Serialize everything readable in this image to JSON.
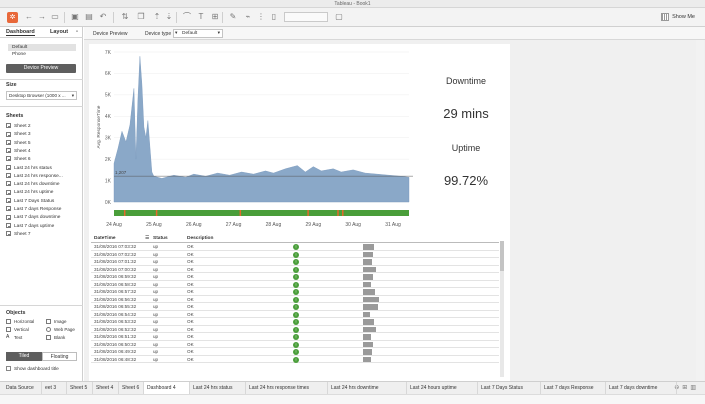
{
  "window": {
    "title": "Tableau - Book1"
  },
  "toolbar": {
    "show_me_label": "Show Me"
  },
  "left_panel": {
    "tabs": [
      {
        "label": "Dashboard"
      },
      {
        "label": "Layout"
      }
    ],
    "device_items": [
      {
        "label": "Default"
      },
      {
        "label": "Phone"
      }
    ],
    "device_preview_button": "Device Preview",
    "size_section": "Size",
    "size_value": "Desktop Browser (1000 x ...",
    "sheets_section": "Sheets",
    "sheets": [
      "Sheet 2",
      "Sheet 3",
      "Sheet 5",
      "Sheet 4",
      "Sheet 6",
      "Last 24 hrs status",
      "Last 24 hrs response...",
      "Last 24 hrs downtime",
      "Last 24 hrs uptime",
      "Last 7 Days Status",
      "Last 7 days Response",
      "Last 7 days downtime",
      "Last 7 days uptime",
      "Sheet 7"
    ],
    "objects_section": "Objects",
    "objects": [
      {
        "label": "Horizontal"
      },
      {
        "label": "Image"
      },
      {
        "label": "Vertical"
      },
      {
        "label": "Web Page"
      },
      {
        "label": "Text"
      },
      {
        "label": "Blank"
      }
    ],
    "tiled_label": "Tiled",
    "floating_label": "Floating",
    "show_title_label": "Show dashboard title"
  },
  "device_bar": {
    "preview_label": "Device Preview",
    "type_label": "Device type",
    "type_value": "Default"
  },
  "kpis": {
    "downtime_label": "Downtime",
    "downtime_value": "29 mins",
    "uptime_label": "Uptime",
    "uptime_value": "99.72%"
  },
  "chart_data": {
    "type": "area",
    "title": "",
    "ylabel": "Avg. ResponseTime",
    "xlabel": "",
    "yticks": [
      "0K",
      "1K",
      "2K",
      "3K",
      "4K",
      "5K",
      "6K",
      "7K"
    ],
    "ylim": [
      0,
      7000
    ],
    "xticks": [
      "24 Aug",
      "25 Aug",
      "26 Aug",
      "27 Aug",
      "28 Aug",
      "29 Aug",
      "30 Aug",
      "31 Aug"
    ],
    "reference_line": {
      "label": "1,207",
      "value": 1207
    },
    "series": [
      {
        "points": [
          [
            0.0,
            1800
          ],
          [
            0.1,
            2500
          ],
          [
            0.2,
            3300
          ],
          [
            0.3,
            2800
          ],
          [
            0.4,
            3600
          ],
          [
            0.5,
            5300
          ],
          [
            0.55,
            2000
          ],
          [
            0.6,
            4800
          ],
          [
            0.65,
            6800
          ],
          [
            0.7,
            5500
          ],
          [
            0.75,
            3500
          ],
          [
            0.8,
            3000
          ],
          [
            0.85,
            3800
          ],
          [
            0.9,
            2600
          ],
          [
            0.95,
            1400
          ],
          [
            1.0,
            1200
          ],
          [
            1.2,
            1100
          ],
          [
            1.5,
            1250
          ],
          [
            1.8,
            1150
          ],
          [
            2.0,
            1300
          ],
          [
            2.3,
            1200
          ],
          [
            2.6,
            1350
          ],
          [
            2.9,
            1250
          ],
          [
            3.2,
            1400
          ],
          [
            3.5,
            1300
          ],
          [
            3.8,
            1450
          ],
          [
            4.0,
            1350
          ],
          [
            4.3,
            1550
          ],
          [
            4.6,
            1700
          ],
          [
            4.8,
            1400
          ],
          [
            5.0,
            1650
          ],
          [
            5.2,
            1450
          ],
          [
            5.5,
            1550
          ],
          [
            5.7,
            1400
          ],
          [
            6.0,
            1500
          ],
          [
            6.3,
            1350
          ],
          [
            6.6,
            1300
          ],
          [
            6.9,
            1250
          ],
          [
            7.2,
            1200
          ],
          [
            7.4,
            1150
          ]
        ]
      }
    ],
    "status_strip": {
      "ok_color": "#4a9e3a",
      "fail_color": "#e36a2c",
      "failures": [
        0.25,
        1.05,
        3.15,
        4.85,
        5.6,
        5.72
      ]
    },
    "color": "#8aa8c8"
  },
  "table": {
    "headers": {
      "datetime": "DateTime",
      "status": "Status",
      "description": "Description"
    },
    "rows": [
      {
        "datetime": "31/08/2016 07:03:32",
        "status": "up",
        "description": "OK",
        "rt": 0.55
      },
      {
        "datetime": "31/08/2016 07:02:32",
        "status": "up",
        "description": "OK",
        "rt": 0.5
      },
      {
        "datetime": "31/08/2016 07:01:32",
        "status": "up",
        "description": "OK",
        "rt": 0.45
      },
      {
        "datetime": "31/08/2016 07:00:32",
        "status": "up",
        "description": "OK",
        "rt": 0.65
      },
      {
        "datetime": "31/08/2016 06:59:32",
        "status": "up",
        "description": "OK",
        "rt": 0.5
      },
      {
        "datetime": "31/08/2016 06:58:32",
        "status": "up",
        "description": "OK",
        "rt": 0.4
      },
      {
        "datetime": "31/08/2016 06:57:32",
        "status": "up",
        "description": "OK",
        "rt": 0.6
      },
      {
        "datetime": "31/08/2016 06:56:32",
        "status": "up",
        "description": "OK",
        "rt": 0.8
      },
      {
        "datetime": "31/08/2016 06:55:32",
        "status": "up",
        "description": "OK",
        "rt": 0.75
      },
      {
        "datetime": "31/08/2016 06:54:32",
        "status": "up",
        "description": "OK",
        "rt": 0.35
      },
      {
        "datetime": "31/08/2016 06:53:32",
        "status": "up",
        "description": "OK",
        "rt": 0.55
      },
      {
        "datetime": "31/08/2016 06:52:32",
        "status": "up",
        "description": "OK",
        "rt": 0.65
      },
      {
        "datetime": "31/08/2016 06:51:32",
        "status": "up",
        "description": "OK",
        "rt": 0.4
      },
      {
        "datetime": "31/08/2016 06:50:32",
        "status": "up",
        "description": "OK",
        "rt": 0.5
      },
      {
        "datetime": "31/08/2016 06:49:32",
        "status": "up",
        "description": "OK",
        "rt": 0.45
      },
      {
        "datetime": "31/08/2016 06:48:32",
        "status": "up",
        "description": "OK",
        "rt": 0.4
      }
    ]
  },
  "bottom_tabs": {
    "items": [
      {
        "label": "Data Source",
        "active": false
      },
      {
        "label": "eet 3",
        "active": false
      },
      {
        "label": "Sheet 5",
        "active": false
      },
      {
        "label": "Sheet 4",
        "active": false
      },
      {
        "label": "Sheet 6",
        "active": false
      },
      {
        "label": "Dashboard 4",
        "active": true
      },
      {
        "label": "Last 24 hrs status",
        "active": false
      },
      {
        "label": "Last 24 hrs response times",
        "active": false
      },
      {
        "label": "Last 24 hrs downtime",
        "active": false
      },
      {
        "label": "Last 24 hours uptime",
        "active": false
      },
      {
        "label": "Last 7 Days Status",
        "active": false
      },
      {
        "label": "Last 7 days Response",
        "active": false
      },
      {
        "label": "Last 7 days downtime",
        "active": false
      }
    ]
  }
}
